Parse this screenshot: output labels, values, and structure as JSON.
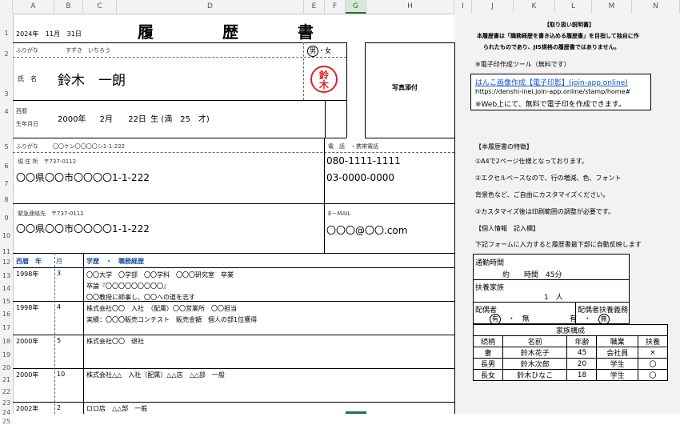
{
  "columns": [
    "A",
    "B",
    "C",
    "D",
    "E",
    "F",
    "G",
    "H",
    "I",
    "J",
    "K",
    "L",
    "M",
    "N"
  ],
  "rows": [
    "1",
    "2",
    "3",
    "4",
    "5",
    "6",
    "7",
    "8",
    "9",
    "10",
    "11",
    "12",
    "13",
    "14",
    "15",
    "16",
    "17",
    "18",
    "19",
    "20",
    "21",
    "22",
    "23",
    "24",
    "25"
  ],
  "resume": {
    "date_year": "2024年",
    "date_month": "11月",
    "date_day": "31日",
    "title_1": "履",
    "title_2": "歴",
    "title_3": "書",
    "furigana_label": "ふりがな",
    "furigana_name": "すずき　いちろう",
    "gender_male": "男",
    "gender_sep": "・",
    "gender_female": "女",
    "name_label": "氏　名",
    "name": "鈴木　一朗",
    "seal_top": "鈴",
    "seal_bottom": "木",
    "photo": "写真添付",
    "birth_label_1": "西暦",
    "birth_label_2": "生年月日",
    "birth_year": "2000年",
    "birth_month": "2月",
    "birth_day": "22日",
    "birth_age": "生 (満　25　才)",
    "addr_furigana_label": "ふりがな",
    "addr_furigana": "〇〇ケン〇〇〇〇シ1-1-222",
    "phone_label": "電　話　・携帯電話",
    "current_addr_label": "現 住 所　〒737-0112",
    "current_addr": "〇〇県〇〇市〇〇〇〇1-1-222",
    "phone1": "080-1111-1111",
    "phone2": "03-0000-0000",
    "emergency_label": "緊急連絡先　〒737-0112",
    "emergency_addr": "〇〇県〇〇市〇〇〇〇1-1-222",
    "email_label": "E－MAIL",
    "email": "〇〇〇@〇〇.com",
    "hist_head_year": "西暦　年",
    "hist_head_month": "月",
    "hist_head_content": "学歴　・　職務経歴",
    "history": [
      {
        "year": "1998年",
        "month": "3",
        "lines": [
          "〇〇大学　〇学部　〇〇学科　〇〇〇研究室　卒業",
          "卒論『〇〇〇〇〇〇〇〇〇』",
          "〇〇教授に師事し、〇〇への道を志す"
        ]
      },
      {
        "year": "1998年",
        "month": "4",
        "lines": [
          "株式会社〇〇　入社　（配属）〇〇営業所　〇〇担当",
          "実績：〇〇〇販売コンテスト　販売金額　個人の部1位獲得"
        ]
      },
      {
        "year": "2000年",
        "month": "5",
        "lines": [
          "株式会社〇〇　退社"
        ]
      },
      {
        "year": "2000年",
        "month": "10",
        "lines": [
          "株式会社△△　入社（配属）△△店　△△部　一般"
        ]
      },
      {
        "year": "2002年",
        "month": "2",
        "lines": [
          "ロロ店　△△部　一般"
        ]
      }
    ]
  },
  "side": {
    "instr_title": "【取り扱い説明書】",
    "instr_line1": "本履歴書は「職務経歴を書き込める履歴書」を目指して独自に作",
    "instr_line2": "られたものであり、JIS規格の履歴書ではありません。",
    "tool_label": "※電子印作成ツール（無料です）",
    "tool_link": "はんこ画像作成【電子印影】(join-app.online)",
    "tool_url": "https://denshi-inei.join-app.online/stamp/home#",
    "tool_note": "※Web上にて、無料で電子印を作成できます。",
    "features_title": "【本履歴書の特徴】",
    "feature1": "①A4で2ページ仕様となっております。",
    "feature2": "②エクセルベースなので、行の増減、色、フォント",
    "feature2b": "背景色など、ご自由にカスタマイズください。",
    "feature3": "③カスタマイズ後は印刷範囲の調整が必要です。",
    "personal_title": "【個人情報　記入欄】",
    "personal_desc": "下記フォームに入力すると履歴書最下部に自動反映します",
    "commute_label": "通勤時間",
    "commute_value": "約　　時間　45分",
    "dependents_label": "扶養家族",
    "dependents_value": "1　人",
    "spouse_label": "配偶者",
    "spouse_yes": "有",
    "spouse_sep": "・",
    "spouse_no": "無",
    "spouse_dep_label": "配偶者扶養義務",
    "spouse_dep_yes": "有",
    "spouse_dep_sep": "・",
    "spouse_dep_no": "無",
    "family_title": "家族構成",
    "family_headers": [
      "続柄",
      "名前",
      "年齢",
      "職業",
      "扶養"
    ],
    "family": [
      [
        "妻",
        "鈴木花子",
        "45",
        "会社員",
        "×"
      ],
      [
        "長男",
        "鈴木次郎",
        "20",
        "学生",
        "〇"
      ],
      [
        "長女",
        "鈴木ひなこ",
        "18",
        "学生",
        "〇"
      ]
    ]
  }
}
